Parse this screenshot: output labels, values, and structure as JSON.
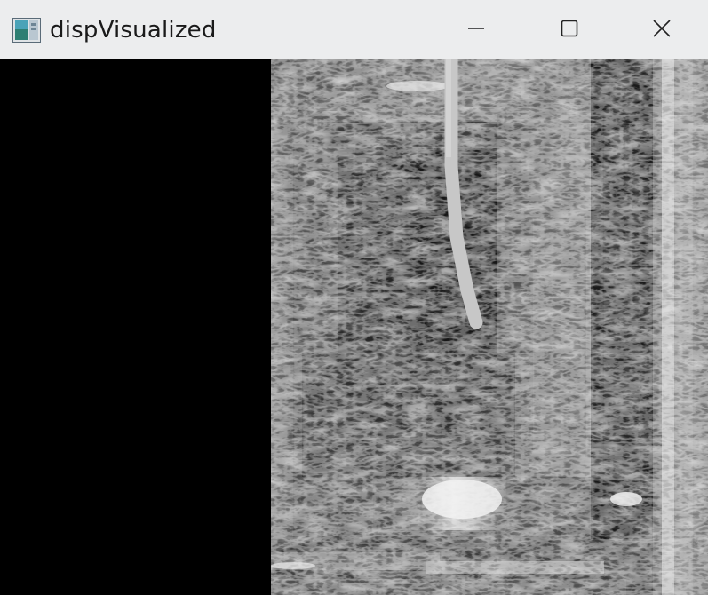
{
  "window": {
    "title": "dispVisualized",
    "icon": "opencv-window-icon",
    "controls": {
      "minimize": "minimize-icon",
      "maximize": "maximize-icon",
      "close": "close-icon"
    }
  },
  "image": {
    "name": "disparity-map",
    "colormap": "grayscale",
    "colors": {
      "background": "#000000",
      "titlebar": "#ecedee"
    }
  }
}
